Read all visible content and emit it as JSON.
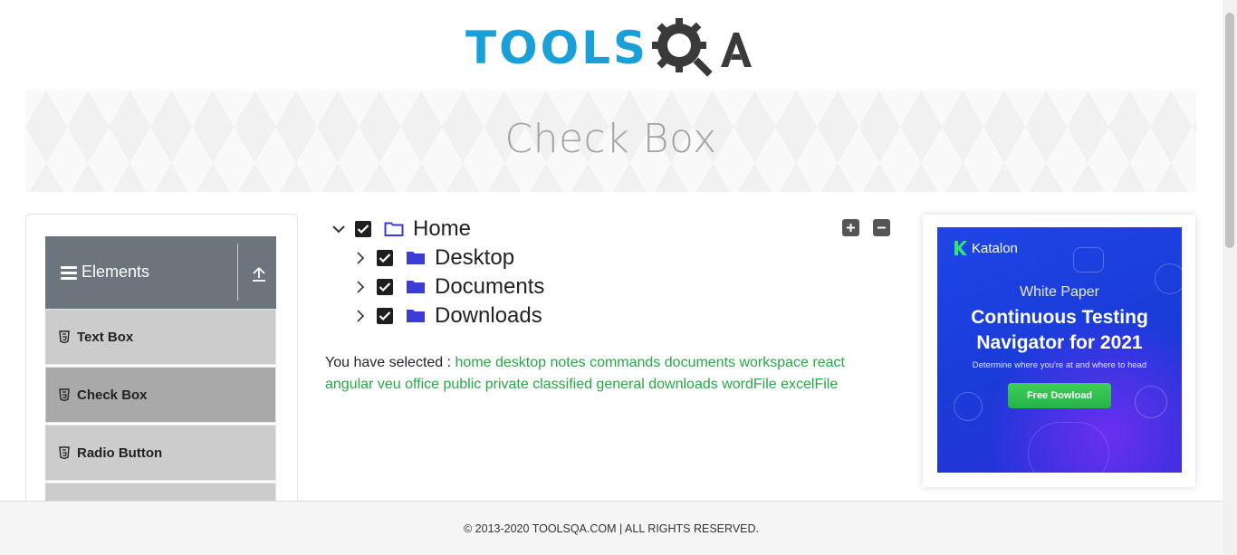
{
  "header": {
    "logo_text_a": "TOOLS",
    "logo_text_b": "QA"
  },
  "banner": {
    "title": "Check Box"
  },
  "sidebar": {
    "group_title": "Elements",
    "items": [
      {
        "label": "Text Box",
        "active": false
      },
      {
        "label": "Check Box",
        "active": true
      },
      {
        "label": "Radio Button",
        "active": false
      }
    ]
  },
  "tree": {
    "root": {
      "label": "Home",
      "expanded": true,
      "checked": true
    },
    "children": [
      {
        "label": "Desktop",
        "expanded": false,
        "checked": true
      },
      {
        "label": "Documents",
        "expanded": false,
        "checked": true
      },
      {
        "label": "Downloads",
        "expanded": false,
        "checked": true
      }
    ],
    "expand_all_label": "+",
    "collapse_all_label": "−"
  },
  "result": {
    "prefix": "You have selected :",
    "line1": "home desktop notes commands documents workspace react",
    "line2": "angular veu office public private classified general downloads wordFile excelFile"
  },
  "ad": {
    "brand": "Katalon",
    "eyebrow": "White Paper",
    "headline_line1": "Continuous Testing",
    "headline_line2": "Navigator for 2021",
    "sub": "Determine where you're at and where to head",
    "cta": "Free Dowload"
  },
  "footer": {
    "text": "© 2013-2020 TOOLSQA.COM | ALL RIGHTS RESERVED."
  },
  "colors": {
    "accent": "#1aa0d8",
    "selected_text": "#28a745",
    "checkbox": "#1f1f1f",
    "folder": "#3b3bd6",
    "sidebar_header": "#6c757d"
  }
}
